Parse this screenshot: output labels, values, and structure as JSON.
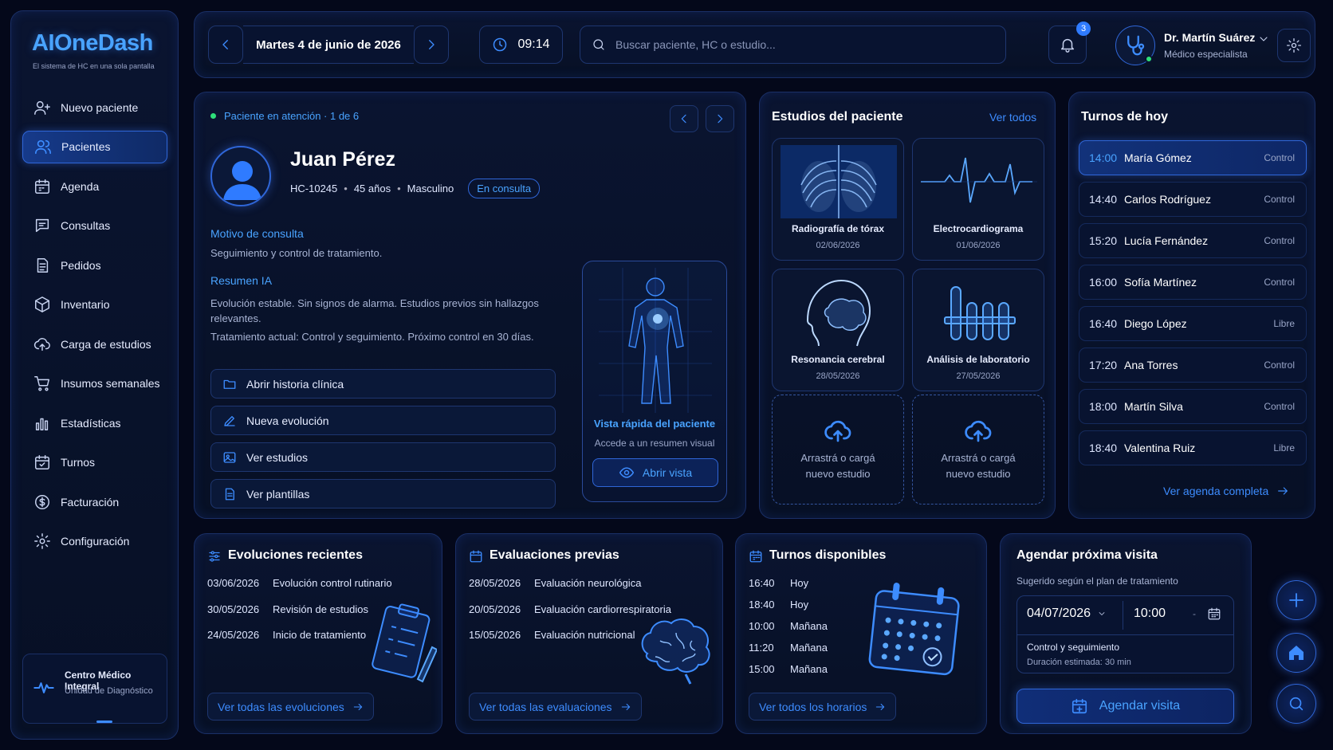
{
  "brand": {
    "logo": "AIOneDash",
    "tagline": "El sistema de HC en una sola pantalla"
  },
  "sidebar": {
    "items": [
      {
        "label": "Nuevo paciente",
        "icon": "user-plus-icon"
      },
      {
        "label": "Pacientes",
        "icon": "users-icon",
        "active": true
      },
      {
        "label": "Agenda",
        "icon": "calendar-icon"
      },
      {
        "label": "Consultas",
        "icon": "chat-icon"
      },
      {
        "label": "Pedidos",
        "icon": "document-icon"
      },
      {
        "label": "Inventario",
        "icon": "box-icon"
      },
      {
        "label": "Carga de estudios",
        "icon": "cloud-upload-icon"
      },
      {
        "label": "Insumos semanales",
        "icon": "cart-icon"
      },
      {
        "label": "Estadísticas",
        "icon": "bar-chart-icon"
      },
      {
        "label": "Turnos",
        "icon": "calendar-check-icon"
      },
      {
        "label": "Facturación",
        "icon": "dollar-icon"
      },
      {
        "label": "Configuración",
        "icon": "gear-icon"
      }
    ],
    "center": {
      "name": "Centro Médico Integral",
      "unit": "Unidad de Diagnóstico"
    }
  },
  "header": {
    "date": "Martes 4 de junio de 2026",
    "time": "09:14",
    "search_placeholder": "Buscar paciente, HC o estudio...",
    "notifications": "3",
    "user_name": "Dr. Martín Suárez",
    "user_role": "Médico especialista"
  },
  "patient": {
    "status": "Paciente en atención · 1 de 6",
    "name": "Juan Pérez",
    "hc": "HC-10245",
    "age": "45 años",
    "sex": "Masculino",
    "state": "En consulta",
    "motivo_title": "Motivo de consulta",
    "motivo": "Seguimiento y control de tratamiento.",
    "resumen_title": "Resumen IA",
    "resumen_1": "Evolución estable. Sin signos de alarma. Estudios previos sin hallazgos relevantes.",
    "resumen_2": "Tratamiento actual: Control y seguimiento. Próximo control en 30 días.",
    "actions": [
      "Abrir historia clínica",
      "Nueva evolución",
      "Ver estudios",
      "Ver plantillas"
    ],
    "quick": {
      "title": "Vista rápida del paciente",
      "subtitle": "Accede a un resumen visual",
      "button": "Abrir vista"
    }
  },
  "studies": {
    "title": "Estudios del paciente",
    "link": "Ver todos",
    "items": [
      {
        "name": "Radiografía de tórax",
        "date": "02/06/2026"
      },
      {
        "name": "Electrocardiograma",
        "date": "01/06/2026"
      },
      {
        "name": "Resonancia cerebral",
        "date": "28/05/2026"
      },
      {
        "name": "Análisis de laboratorio",
        "date": "27/05/2026"
      }
    ],
    "upload_1": "Arrastrá o cargá nuevo estudio",
    "upload_2": "Arrastrá o cargá nuevo estudio"
  },
  "turnos": {
    "title": "Turnos de hoy",
    "items": [
      {
        "time": "14:00",
        "name": "María Gómez",
        "type": "Control"
      },
      {
        "time": "14:40",
        "name": "Carlos Rodríguez",
        "type": "Control"
      },
      {
        "time": "15:20",
        "name": "Lucía Fernández",
        "type": "Control"
      },
      {
        "time": "16:00",
        "name": "Sofía Martínez",
        "type": "Control"
      },
      {
        "time": "16:40",
        "name": "Diego López",
        "type": "Libre"
      },
      {
        "time": "17:20",
        "name": "Ana Torres",
        "type": "Control"
      },
      {
        "time": "18:00",
        "name": "Martín Silva",
        "type": "Control"
      },
      {
        "time": "18:40",
        "name": "Valentina Ruiz",
        "type": "Libre"
      }
    ],
    "link": "Ver agenda completa"
  },
  "evoluciones": {
    "title": "Evoluciones recientes",
    "rows": [
      {
        "date": "03/06/2026",
        "text": "Evolución control rutinario"
      },
      {
        "date": "30/05/2026",
        "text": "Revisión de estudios"
      },
      {
        "date": "24/05/2026",
        "text": "Inicio de tratamiento"
      }
    ],
    "link": "Ver todas las evoluciones"
  },
  "evaluaciones": {
    "title": "Evaluaciones previas",
    "rows": [
      {
        "date": "28/05/2026",
        "text": "Evaluación neurológica"
      },
      {
        "date": "20/05/2026",
        "text": "Evaluación cardiorrespiratoria"
      },
      {
        "date": "15/05/2026",
        "text": "Evaluación nutricional"
      }
    ],
    "link": "Ver todas las evaluaciones"
  },
  "disponibles": {
    "title": "Turnos disponibles",
    "rows": [
      {
        "time": "16:40",
        "day": "Hoy"
      },
      {
        "time": "18:40",
        "day": "Hoy"
      },
      {
        "time": "10:00",
        "day": "Mañana"
      },
      {
        "time": "11:20",
        "day": "Mañana"
      },
      {
        "time": "15:00",
        "day": "Mañana"
      }
    ],
    "link": "Ver todos los horarios"
  },
  "agendar": {
    "title": "Agendar próxima visita",
    "subtitle": "Sugerido según el plan de tratamiento",
    "date": "04/07/2026",
    "time": "10:00",
    "type": "Control y seguimiento",
    "duration": "Duración estimada: 30 min",
    "button": "Agendar visita"
  },
  "colors": {
    "accent": "#3d8cff",
    "background": "#04081a",
    "panel": "#0a1430",
    "online": "#2ee07a"
  }
}
